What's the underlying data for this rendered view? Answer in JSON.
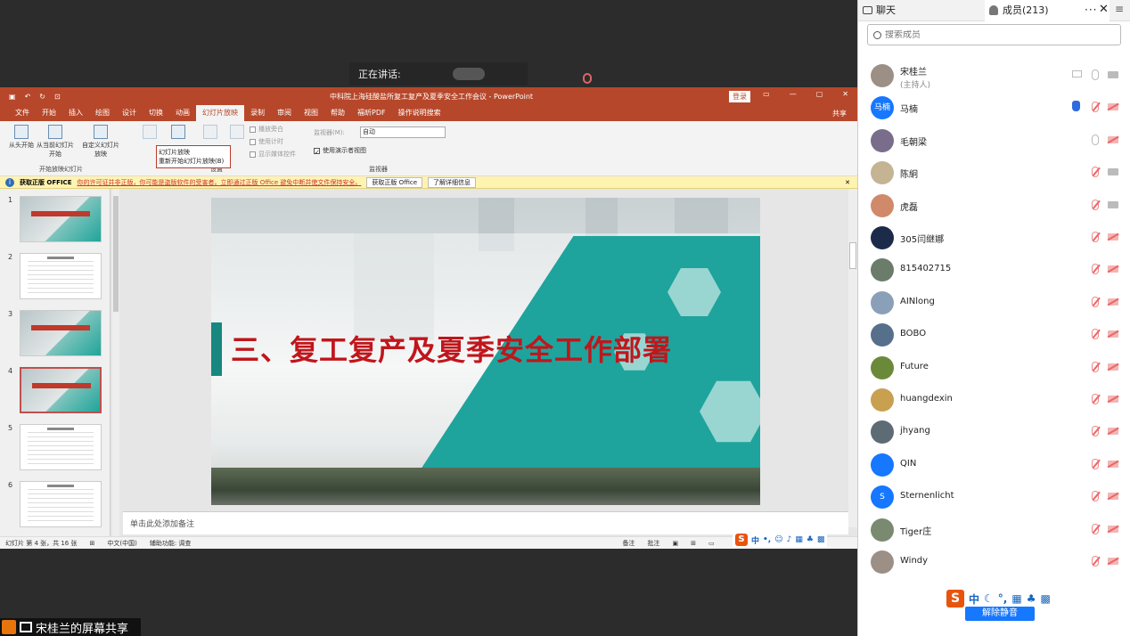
{
  "meeting": {
    "speaking_label": "正在讲话:",
    "share_label": "宋桂兰的屏幕共享"
  },
  "ppt": {
    "doc_title": "中科院上海硅酸盐所复工复产及夏季安全工作会议 - PowerPoint",
    "login_label": "登录",
    "menu_tabs": [
      "文件",
      "开始",
      "插入",
      "绘图",
      "设计",
      "切换",
      "动画",
      "幻灯片放映",
      "录制",
      "审阅",
      "视图",
      "帮助",
      "福昕PDF",
      "操作说明搜索"
    ],
    "active_tab": "幻灯片放映",
    "share_label": "共享",
    "ribbon": {
      "from_start": "从头开始",
      "from_current": "从当前幻灯片开始",
      "custom": "自定义幻灯片放映",
      "group_start": "开始放映幻灯片",
      "play_narration": "播放旁白",
      "use_timing": "使用计时",
      "show_media_controls": "显示媒体控件",
      "monitor_label": "监视器(M):",
      "monitor_value": "自动",
      "presenter_view": "使用演示者视图",
      "group_monitor": "监视器",
      "group_setup": "设置",
      "popup_title": "幻灯片放映",
      "popup_item": "重新开始幻灯片放映(B)"
    },
    "infobar": {
      "title": "获取正版 OFFICE",
      "message": "你的许可证并非正版，你可能是盗版软件的受害者。立即通过正版 Office 避免中断并使文件保持安全。",
      "btn_get": "获取正版 Office",
      "btn_learn": "了解详细信息"
    },
    "thumbnails": [
      {
        "num": "1",
        "kind": "cover"
      },
      {
        "num": "2",
        "kind": "text"
      },
      {
        "num": "3",
        "kind": "cover"
      },
      {
        "num": "4",
        "kind": "cover",
        "selected": true
      },
      {
        "num": "5",
        "kind": "text"
      },
      {
        "num": "6",
        "kind": "text"
      }
    ],
    "slide_heading": "三、复工复产及夏季安全工作部署",
    "notes_placeholder": "单击此处添加备注",
    "status": {
      "slide_count": "幻灯片 第 4 张，共 16 张",
      "language": "中文(中国)",
      "accessibility": "辅助功能: 调查",
      "notes": "备注",
      "comments": "批注"
    }
  },
  "panel": {
    "tab_chat": "聊天",
    "tab_members": "成员(213)",
    "search_placeholder": "搜索成员",
    "unmute_label": "解除静音",
    "members": [
      {
        "name": "宋桂兰",
        "sub": "(主持人)",
        "avatar": "",
        "mic": "on",
        "cam": "on",
        "screen": true
      },
      {
        "name": "马楠",
        "avatar": "马楠",
        "avatar_color": "#1677ff",
        "mic": "off",
        "cam": "off",
        "hand": true
      },
      {
        "name": "毛朝梁",
        "avatar": "",
        "mic": "on",
        "cam": "off"
      },
      {
        "name": "陈絅",
        "avatar": "",
        "mic": "off",
        "cam": "on"
      },
      {
        "name": "虎磊",
        "avatar": "",
        "mic": "off",
        "cam": "on"
      },
      {
        "name": "305闫继娜",
        "avatar": "",
        "mic": "off",
        "cam": "off"
      },
      {
        "name": "815402715",
        "avatar": "",
        "mic": "off",
        "cam": "off"
      },
      {
        "name": "AINlong",
        "avatar": "",
        "mic": "off",
        "cam": "off"
      },
      {
        "name": "BOBO",
        "avatar": "",
        "mic": "off",
        "cam": "off"
      },
      {
        "name": "Future",
        "avatar": "",
        "mic": "off",
        "cam": "off"
      },
      {
        "name": "huangdexin",
        "avatar": "",
        "mic": "off",
        "cam": "off"
      },
      {
        "name": "jhyang",
        "avatar": "",
        "mic": "off",
        "cam": "off"
      },
      {
        "name": "QIN",
        "avatar": "",
        "mic": "off",
        "cam": "off"
      },
      {
        "name": "Sternenlicht",
        "avatar": "S",
        "avatar_color": "#1677ff",
        "mic": "off",
        "cam": "off"
      },
      {
        "name": "Tiger庄",
        "avatar": "",
        "mic": "off",
        "cam": "off"
      },
      {
        "name": "Windy",
        "avatar": "",
        "mic": "off",
        "cam": "off"
      }
    ]
  },
  "colors": {
    "ppt_accent": "#b7472a",
    "slide_title": "#c0161c",
    "teal": "#1ea49c",
    "unmute": "#1677ff"
  }
}
